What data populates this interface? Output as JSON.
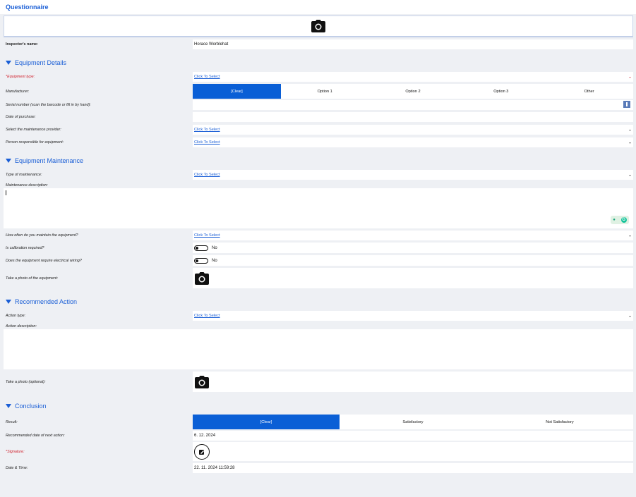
{
  "header": {
    "title": "Questionnaire"
  },
  "inspector": {
    "label": "Inspector's name:",
    "value": "Horace Worblehat"
  },
  "equipment_details": {
    "heading": "Equipment Details",
    "equipment_type": {
      "required_mark": "* ",
      "label": "Equipment type:",
      "value": "Click To Select"
    },
    "manufacturer": {
      "label": "Manufacturer:",
      "options": [
        "[Clear]",
        "Option 1",
        "Option 2",
        "Option 3",
        "Other"
      ],
      "selected": "[Clear]"
    },
    "serial": {
      "label": "Serial number (scan the barcode or fill in by hand):",
      "value": ""
    },
    "purchase_date": {
      "label": "Date of purchase:",
      "value": ""
    },
    "provider": {
      "label": "Select the maintenance provider:",
      "value": "Click To Select"
    },
    "responsible": {
      "label": "Person responsible for equipment:",
      "value": "Click To Select"
    }
  },
  "equipment_maintenance": {
    "heading": "Equipment Maintenance",
    "type": {
      "label": "Type of maintenance:",
      "value": "Click To Select"
    },
    "description": {
      "label": "Maintenance description:",
      "value": ""
    },
    "frequency": {
      "label": "How often do you maintain the equipment?",
      "value": "Click To Select"
    },
    "calibration": {
      "label": "Is calibration required?",
      "value": "No"
    },
    "wiring": {
      "label": "Does the equipment require electrical wiring?",
      "value": "No"
    },
    "photo": {
      "label": "Take a photo of the equipment:"
    }
  },
  "recommended_action": {
    "heading": "Recommended Action",
    "type": {
      "label": "Action type:",
      "value": "Click To Select"
    },
    "description": {
      "label": "Action description:",
      "value": ""
    },
    "photo": {
      "label": "Take a photo (optional):"
    }
  },
  "conclusion": {
    "heading": "Conclusion",
    "result": {
      "label": "Result:",
      "options": [
        "[Clear]",
        "Satisfactory",
        "Not Satisfactory"
      ],
      "selected": "[Clear]"
    },
    "next_date": {
      "label": "Recommended date of next action:",
      "value": "6. 12. 2024"
    },
    "signature": {
      "required_mark": "* ",
      "label": "Signature:"
    },
    "datetime": {
      "label": "Date & Time:",
      "value": "22. 11. 2024 11:59:28"
    }
  },
  "colors": {
    "accent": "#0a5fd6",
    "required": "#d0202c",
    "background": "#eef0f4"
  },
  "icons": [
    "camera-icon",
    "chevron-down-icon",
    "qr-scan-icon",
    "triangle-down-icon",
    "signature-icon",
    "grammarly-icon"
  ]
}
